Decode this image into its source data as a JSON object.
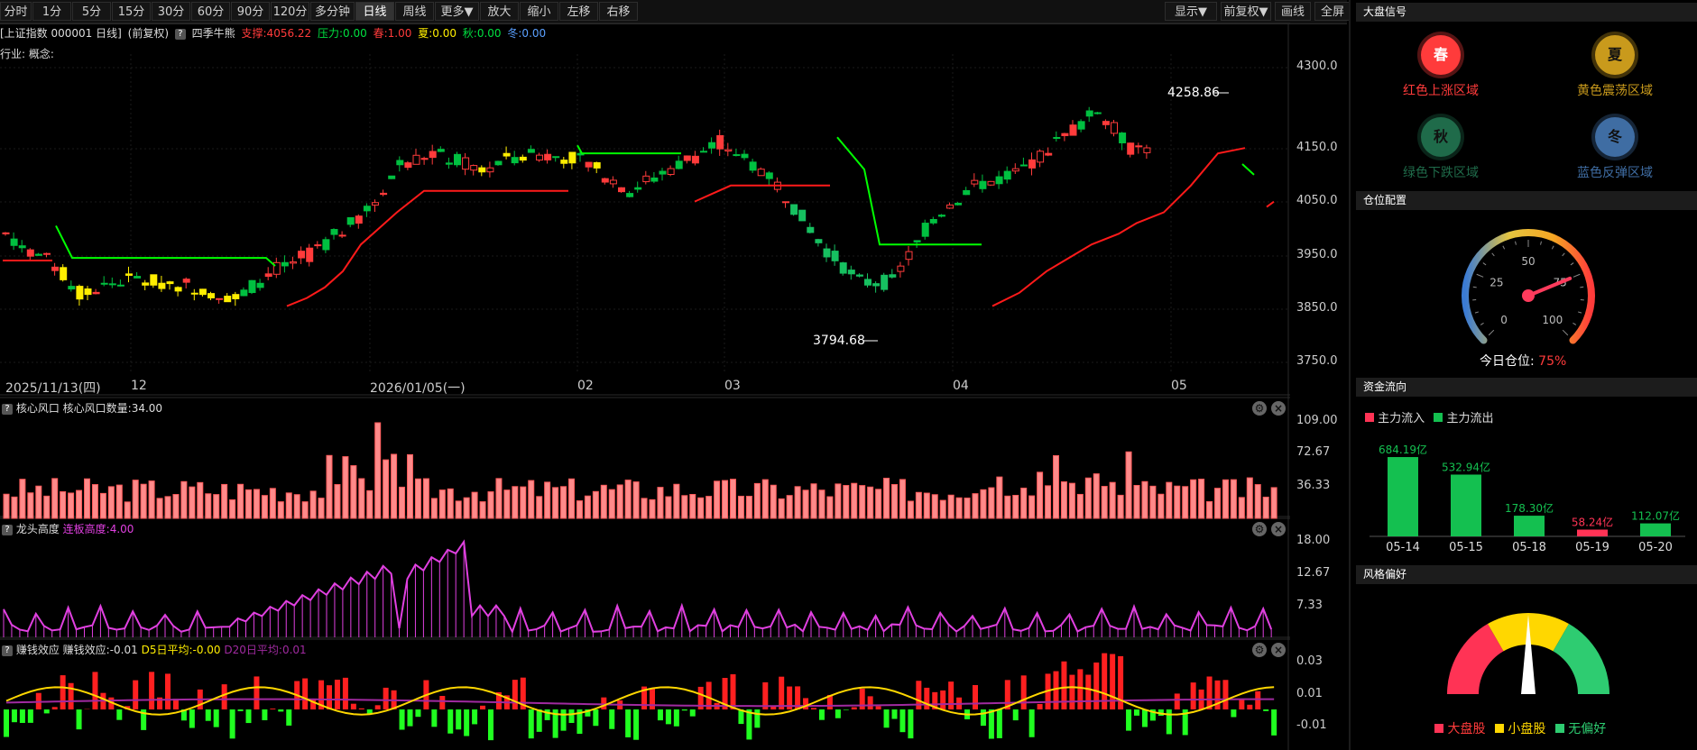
{
  "toolbar": {
    "left": [
      "分时",
      "1分",
      "5分",
      "15分",
      "30分",
      "60分",
      "90分",
      "120分",
      "多分钟",
      "日线",
      "周线",
      "更多▼",
      "放大",
      "缩小",
      "左移",
      "右移"
    ],
    "right": [
      "显示▼",
      "前复权▼",
      "画线",
      "全屏"
    ],
    "active": "日线"
  },
  "info": {
    "symbol": "[上证指数 000001 日线]",
    "adj": "(前复权)",
    "q": "?",
    "indicator": "四季牛熊",
    "support": "支撑:4056.22",
    "pressure": "压力:0.00",
    "spring": "春:1.00",
    "summer": "夏:0.00",
    "autumn": "秋:0.00",
    "winter": "冬:0.00"
  },
  "industry": "行业: 概念:",
  "main_axis": [
    "4300.0",
    "4150.0",
    "4050.0",
    "3950.0",
    "3850.0",
    "3750.0"
  ],
  "dates": [
    "2025/11/13(四)",
    "12",
    "2026/01/05(一)",
    "02",
    "03",
    "04",
    "05"
  ],
  "annotations": {
    "high": "4258.86",
    "low": "3794.68"
  },
  "panel1": {
    "title": "核心风口",
    "value": "核心风口数量:34.00",
    "axis": [
      "109.00",
      "72.67",
      "36.33"
    ]
  },
  "panel2": {
    "title": "龙头高度",
    "value": "连板高度:4.00",
    "axis": [
      "18.00",
      "12.67",
      "7.33"
    ]
  },
  "panel3": {
    "title": "赚钱效应",
    "value": "赚钱效应:-0.01",
    "d5": "D5日平均:-0.00",
    "d20": "D20日平均:0.01",
    "axis": [
      "0.03",
      "0.01",
      "-0.01"
    ]
  },
  "sidebar": {
    "signal_title": "大盘信号",
    "seasons": [
      {
        "icon": "春",
        "label": "红色上涨区域",
        "color": "#ff3b3b"
      },
      {
        "icon": "夏",
        "label": "黄色震荡区域",
        "color": "#c99a1c"
      },
      {
        "icon": "秋",
        "label": "绿色下跌区域",
        "color": "#1f6b4a"
      },
      {
        "icon": "冬",
        "label": "蓝色反弹区域",
        "color": "#3f6da3"
      }
    ],
    "position_title": "仓位配置",
    "gauge_ticks": [
      "0",
      "25",
      "50",
      "75",
      "100"
    ],
    "position_label": "今日仓位:",
    "position_value": "75%",
    "position_level": 0.75,
    "flow_title": "资金流向",
    "legend_in": "主力流入",
    "legend_out": "主力流出",
    "flows": [
      {
        "date": "05-14",
        "label": "684.19亿",
        "value": 684.19,
        "dir": "out"
      },
      {
        "date": "05-15",
        "label": "532.94亿",
        "value": 532.94,
        "dir": "out"
      },
      {
        "date": "05-18",
        "label": "178.30亿",
        "value": 178.3,
        "dir": "out"
      },
      {
        "date": "05-19",
        "label": "58.24亿",
        "value": 58.24,
        "dir": "in"
      },
      {
        "date": "05-20",
        "label": "112.07亿",
        "value": 112.07,
        "dir": "out"
      }
    ],
    "style_title": "风格偏好",
    "style_legend": [
      "大盘股",
      "小盘股",
      "无偏好"
    ],
    "style_needle": 0.5
  },
  "colors": {
    "up": "#ff3b3b",
    "down": "#00c040",
    "yellow": "#ffee00",
    "green_line": "#00ff00",
    "red_line": "#ff1a1a",
    "magenta": "#e040e0",
    "gold": "#ffd700"
  }
}
